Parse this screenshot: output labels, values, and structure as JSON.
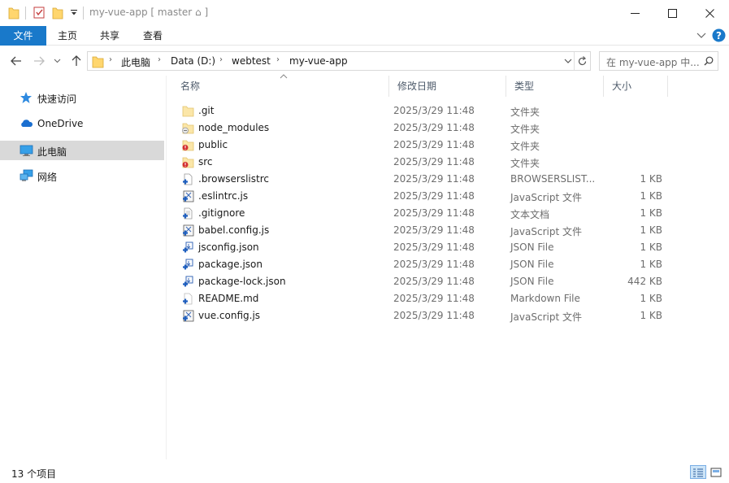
{
  "window": {
    "title": "my-vue-app [ master ⌂ ]",
    "controls": [
      "minimize",
      "maximize",
      "close"
    ]
  },
  "ribbon": {
    "tabs": [
      {
        "label": "文件",
        "active": true
      },
      {
        "label": "主页"
      },
      {
        "label": "共享"
      },
      {
        "label": "查看"
      }
    ],
    "accent": "#1979ca"
  },
  "address": {
    "crumbs": [
      "此电脑",
      "Data (D:)",
      "webtest",
      "my-vue-app"
    ],
    "search_placeholder": "在 my-vue-app 中..."
  },
  "nav": {
    "items": [
      {
        "label": "快速访问",
        "icon": "star-icon"
      },
      {
        "label": "OneDrive",
        "icon": "cloud-icon"
      },
      {
        "label": "此电脑",
        "icon": "computer-icon",
        "selected": true
      },
      {
        "label": "网络",
        "icon": "network-icon"
      }
    ]
  },
  "columns": {
    "name": "名称",
    "date": "修改日期",
    "type": "类型",
    "size": "大小"
  },
  "files": [
    {
      "name": ".git",
      "date": "2025/3/29 11:48",
      "type": "文件夹",
      "size": "",
      "icon": "folder-icon"
    },
    {
      "name": "node_modules",
      "date": "2025/3/29 11:48",
      "type": "文件夹",
      "size": "",
      "icon": "folder-ignored-icon"
    },
    {
      "name": "public",
      "date": "2025/3/29 11:48",
      "type": "文件夹",
      "size": "",
      "icon": "folder-modified-icon"
    },
    {
      "name": "src",
      "date": "2025/3/29 11:48",
      "type": "文件夹",
      "size": "",
      "icon": "folder-modified-icon"
    },
    {
      "name": ".browserslistrc",
      "date": "2025/3/29 11:48",
      "type": "BROWSERSLIST...",
      "size": "1 KB",
      "icon": "file-added-icon"
    },
    {
      "name": ".eslintrc.js",
      "date": "2025/3/29 11:48",
      "type": "JavaScript 文件",
      "size": "1 KB",
      "icon": "js-file-added-icon"
    },
    {
      "name": ".gitignore",
      "date": "2025/3/29 11:48",
      "type": "文本文档",
      "size": "1 KB",
      "icon": "text-file-added-icon"
    },
    {
      "name": "babel.config.js",
      "date": "2025/3/29 11:48",
      "type": "JavaScript 文件",
      "size": "1 KB",
      "icon": "js-file-added-icon"
    },
    {
      "name": "jsconfig.json",
      "date": "2025/3/29 11:48",
      "type": "JSON File",
      "size": "1 KB",
      "icon": "json-file-added-icon"
    },
    {
      "name": "package.json",
      "date": "2025/3/29 11:48",
      "type": "JSON File",
      "size": "1 KB",
      "icon": "json-file-added-icon"
    },
    {
      "name": "package-lock.json",
      "date": "2025/3/29 11:48",
      "type": "JSON File",
      "size": "442 KB",
      "icon": "json-file-added-icon"
    },
    {
      "name": "README.md",
      "date": "2025/3/29 11:48",
      "type": "Markdown File",
      "size": "1 KB",
      "icon": "md-file-added-icon"
    },
    {
      "name": "vue.config.js",
      "date": "2025/3/29 11:48",
      "type": "JavaScript 文件",
      "size": "1 KB",
      "icon": "js-file-added-icon"
    }
  ],
  "status": {
    "count": "13 个项目"
  }
}
